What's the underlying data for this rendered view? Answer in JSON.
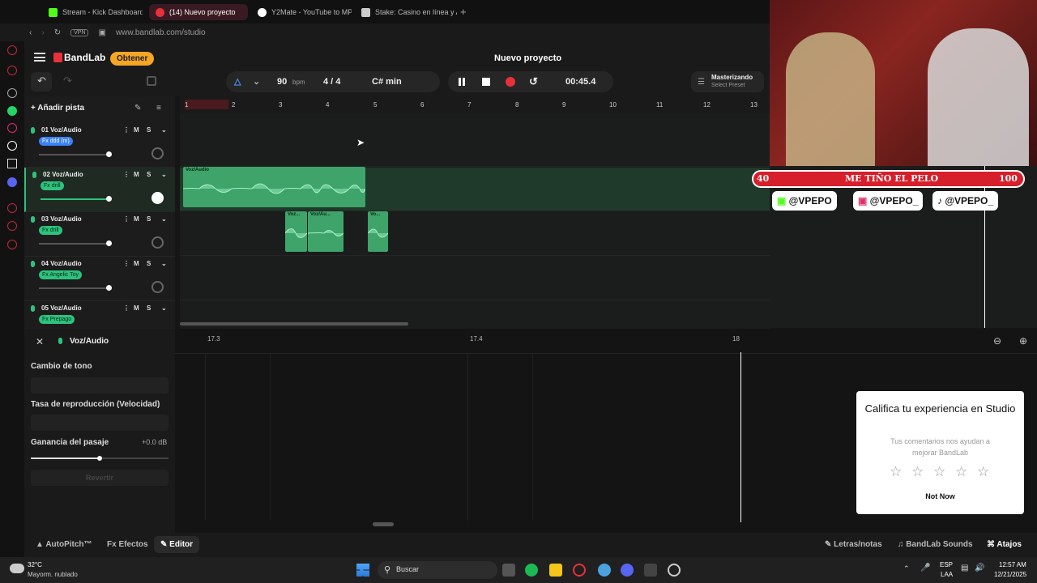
{
  "browser": {
    "tabs": [
      {
        "title": "Stream - Kick Dashboard",
        "color": "#53fc18"
      },
      {
        "title": "(14) Nuevo proyecto",
        "color": "#e8303b",
        "active": true
      },
      {
        "title": "Y2Mate - YouTube to MP",
        "color": "#ffffff"
      },
      {
        "title": "Stake: Casino en línea y A",
        "color": "#ffffff"
      }
    ],
    "vpn_label": "VPN",
    "url": "www.bandlab.com/studio"
  },
  "header": {
    "brand": "BandLab",
    "obtener_label": "Obtener",
    "project_title": "Nuevo proyecto",
    "bpm_value": "90",
    "bpm_unit": "bpm",
    "time_signature": "4 / 4",
    "key": "C# min",
    "time": "00:45.4",
    "mastering_title": "Masterizando",
    "mastering_sub": "Select Preset"
  },
  "tracks_panel": {
    "add_track_label": "Añadir pista",
    "tracks": [
      {
        "name": "01 Voz/Audio",
        "fx": "Fx ddd (m)",
        "fx_color": "blue"
      },
      {
        "name": "02 Voz/Audio",
        "fx": "Fx drill",
        "fx_color": "green"
      },
      {
        "name": "03 Voz/Audio",
        "fx": "Fx drill",
        "fx_color": "green"
      },
      {
        "name": "04 Voz/Audio",
        "fx": "Fx Angelic Toy",
        "fx_color": "green"
      },
      {
        "name": "05 Voz/Audio",
        "fx": "Fx Prepago",
        "fx_color": "green"
      }
    ],
    "mute_label": "M",
    "solo_label": "S"
  },
  "timeline": {
    "bars": [
      "1",
      "2",
      "3",
      "4",
      "5",
      "6",
      "7",
      "8",
      "9",
      "10",
      "11",
      "12",
      "13"
    ],
    "clips": [
      {
        "label": "Voz/Audio"
      },
      {
        "label": "Voz..."
      },
      {
        "label": "Voz/Au..."
      },
      {
        "label": "Vo..."
      }
    ]
  },
  "stream_overlay": {
    "bar_left": "40",
    "bar_text": "ME TIÑO EL PELO",
    "bar_right": "100",
    "socials": [
      "@VPEPO",
      "@VPEPO_",
      "@VPEPO_"
    ]
  },
  "editor": {
    "title": "Voz/Audio",
    "pitch_label": "Cambio de tono",
    "rate_label": "Tasa de reproducción (Velocidad)",
    "gain_label": "Ganancia del pasaje",
    "gain_value": "+0.0 dB",
    "revert_label": "Revertir",
    "ruler": [
      "17.3",
      "17.4",
      "18"
    ]
  },
  "bottom_bar": {
    "autopitch": "AutoPitch™",
    "effects": "Efectos",
    "editor": "Editor",
    "lyrics": "Letras/notas",
    "sounds": "BandLab Sounds",
    "shortcuts": "Atajos"
  },
  "rating_card": {
    "title": "Califica tu experiencia en Studio",
    "subtitle": "Tus comentarios nos ayudan a mejorar BandLab",
    "dismiss": "Not Now"
  },
  "taskbar": {
    "temperature": "32°C",
    "weather": "Mayorm. nublado",
    "search_label": "Buscar",
    "lang": "ESP",
    "lang_sub": "LAA",
    "clock_time": "12:57 AM",
    "clock_date": "12/21/2025"
  }
}
